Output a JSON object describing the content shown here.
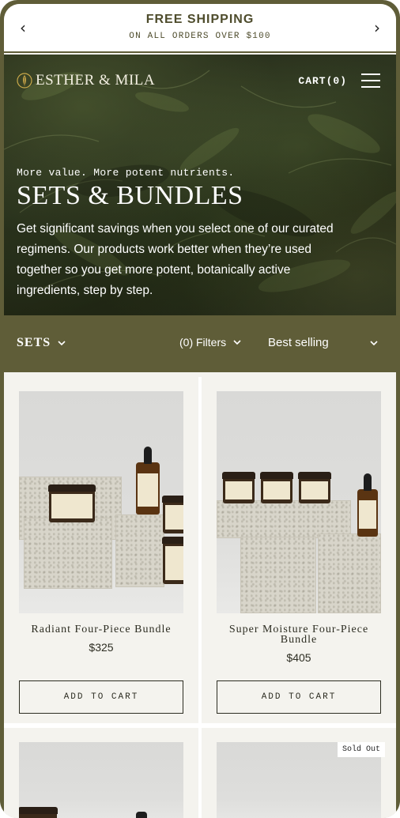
{
  "announcement": {
    "title": "FREE SHIPPING",
    "subtitle": "ON ALL ORDERS OVER $100",
    "prev_icon": "chevron-left-icon",
    "next_icon": "chevron-right-icon"
  },
  "header": {
    "brand": "ESTHER & MILA",
    "cart_label": "CART(0)",
    "menu_icon": "hamburger-menu-icon"
  },
  "hero": {
    "eyebrow": "More value. More potent nutrients.",
    "title": "SETS & BUNDLES",
    "description": "Get significant savings when you select one of our curated regimens. Our products work better when they’re used together so you get more potent, botanically active ingredients, step by step."
  },
  "toolbar": {
    "collection_label": "SETS",
    "filters_label": "(0) Filters",
    "sort_label": "Best selling"
  },
  "products": [
    {
      "name": "Radiant Four-Piece Bundle",
      "price": "$325",
      "button": "ADD TO CART"
    },
    {
      "name": "Super Moisture Four-Piece Bundle",
      "price": "$405",
      "button": "ADD TO CART"
    },
    {
      "name": "",
      "price": "",
      "button": ""
    },
    {
      "name": "",
      "price": "",
      "badge": "Sold Out"
    }
  ],
  "colors": {
    "brand_olive": "#5f5d38",
    "card_bg": "#f4f3ee",
    "text_dark": "#2d2d22"
  }
}
